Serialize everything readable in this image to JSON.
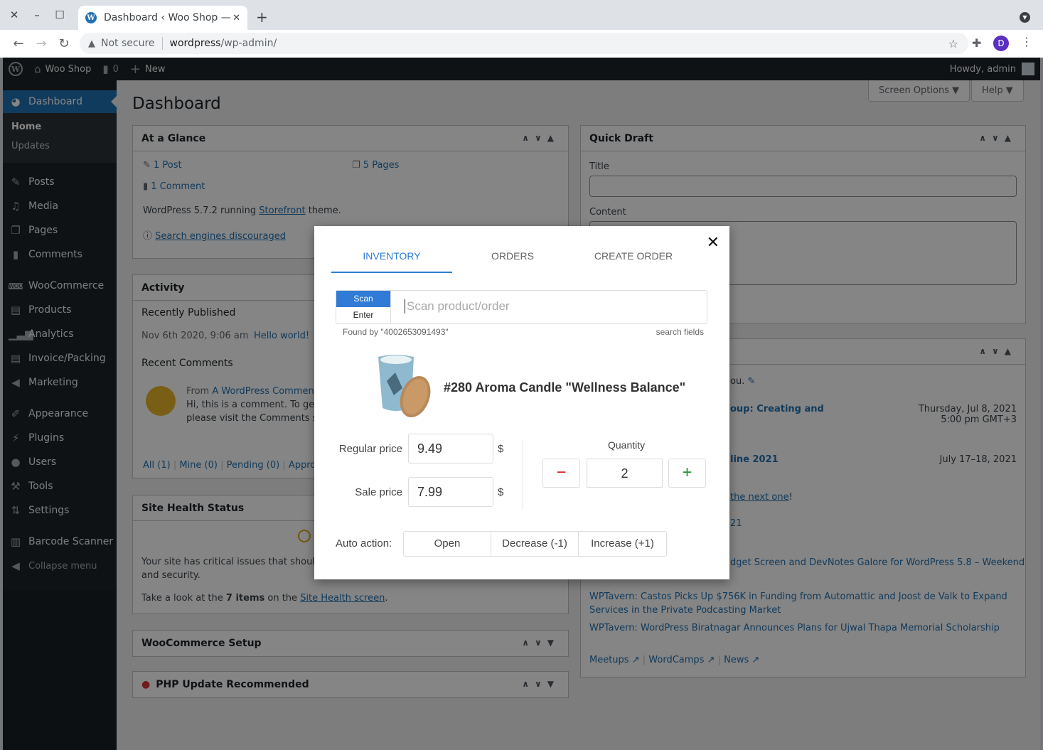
{
  "browser": {
    "tab_title": "Dashboard ‹ Woo Shop —",
    "url_warning": "Not secure",
    "url_host": "wordpress",
    "url_path": "/wp-admin/",
    "profile_initial": "D"
  },
  "adminbar": {
    "site_name": "Woo Shop",
    "comments_count": "0",
    "new_label": "New",
    "howdy": "Howdy, admin"
  },
  "sidebar": {
    "active": "Dashboard",
    "submenu": [
      "Home",
      "Updates"
    ],
    "items": [
      {
        "label": "Posts",
        "icon": "pin-icon"
      },
      {
        "label": "Media",
        "icon": "media-icon"
      },
      {
        "label": "Pages",
        "icon": "pages-icon"
      },
      {
        "label": "Comments",
        "icon": "comment-icon"
      },
      {
        "label": "WooCommerce",
        "icon": "woo-icon"
      },
      {
        "label": "Products",
        "icon": "archive-icon"
      },
      {
        "label": "Analytics",
        "icon": "chart-icon"
      },
      {
        "label": "Invoice/Packing",
        "icon": "document-icon"
      },
      {
        "label": "Marketing",
        "icon": "megaphone-icon"
      },
      {
        "label": "Appearance",
        "icon": "brush-icon"
      },
      {
        "label": "Plugins",
        "icon": "plug-icon"
      },
      {
        "label": "Users",
        "icon": "user-icon"
      },
      {
        "label": "Tools",
        "icon": "wrench-icon"
      },
      {
        "label": "Settings",
        "icon": "settings-icon"
      },
      {
        "label": "Barcode Scanner",
        "icon": "barcode-icon"
      }
    ],
    "collapse": "Collapse menu"
  },
  "page": {
    "title": "Dashboard",
    "screen_options": "Screen Options ▼",
    "help": "Help ▼"
  },
  "glance": {
    "title": "At a Glance",
    "posts": "1 Post",
    "pages": "5 Pages",
    "comments": "1 Comment",
    "wp_text": "WordPress 5.7.2 running ",
    "theme": "Storefront",
    "theme_suffix": " theme.",
    "search_engines": "Search engines discouraged"
  },
  "activity": {
    "title": "Activity",
    "recently_published": "Recently Published",
    "date": "Nov 6th 2020, 9:06 am",
    "post": "Hello world!",
    "recent_comments": "Recent Comments",
    "from": "From ",
    "commenter": "A WordPress Commente",
    "comment_line1": "Hi, this is a comment. To get st",
    "comment_line2": "please visit the Comments scr",
    "filters": [
      "All (1)",
      "Mine (0)",
      "Pending (0)",
      "Approv"
    ]
  },
  "health": {
    "title": "Site Health Status",
    "text1": "Your site has critical issues that should be",
    "text2": "and security.",
    "take_look": "Take a look at the ",
    "items": "7 items",
    "on_the": " on the ",
    "link": "Site Health screen",
    "end": "."
  },
  "woosetup": {
    "title": "WooCommerce Setup"
  },
  "php": {
    "title": "PHP Update Recommended"
  },
  "quickdraft": {
    "title": "Quick Draft",
    "title_label": "Title",
    "content_label": "Content"
  },
  "events": {
    "intro_tail": "ou.",
    "event1": "oup: Creating and",
    "event1_date": "Thursday, Jul 8, 2021",
    "event1_time": "5:00 pm GMT+3",
    "event2": "line 2021",
    "event2_date": "July 17–18, 2021",
    "next_one": " the next one",
    "next_tail": "!",
    "news0": "21",
    "news1": "dget Screen and DevNotes Galore for WordPress 5.8 – Weekend",
    "news2": "WPTavern: Castos Picks Up $756K in Funding from Automattic and Joost de Valk to Expand Services in the Private Podcasting Market",
    "news3": "WPTavern: WordPress Biratnagar Announces Plans for Ujwal Thapa Memorial Scholarship",
    "footer": [
      "Meetups",
      "WordCamps",
      "News"
    ]
  },
  "modal": {
    "tabs": [
      "INVENTORY",
      "ORDERS",
      "CREATE ORDER"
    ],
    "active_tab": "INVENTORY",
    "mode_scan": "Scan",
    "mode_enter": "Enter",
    "scan_placeholder": "Scan product/order",
    "found_by": "Found by \"4002653091493\"",
    "search_fields": "search fields",
    "product_title": "#280 Aroma Candle \"Wellness Balance\"",
    "regular_price_label": "Regular price",
    "regular_price": "9.49",
    "sale_price_label": "Sale price",
    "sale_price": "7.99",
    "currency": "$",
    "quantity_label": "Quantity",
    "quantity": "2",
    "auto_action_label": "Auto action:",
    "auto_actions": [
      "Open",
      "Decrease (-1)",
      "Increase (+1)"
    ],
    "colors": {
      "accent": "#2f7bd5",
      "minus": "#e02020",
      "plus": "#1f9a3a"
    }
  }
}
